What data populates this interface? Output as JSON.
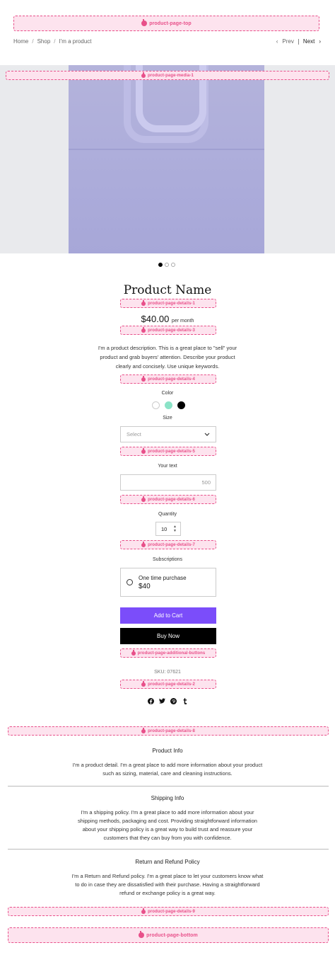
{
  "slots": {
    "top": "product-page-top",
    "media1": "product-page-media-1",
    "details1": "product-page-details-1",
    "details3": "product-page-details-3",
    "details4": "product-page-details-4",
    "details5": "product-page-details-5",
    "details6": "product-page-details-6",
    "details7": "product-page-details-7",
    "additional_buttons": "product-page-additional-buttons",
    "details2": "product-page-details-2",
    "details8": "product-page-details-8",
    "details9": "product-page-details-9",
    "bottom": "product-page-bottom"
  },
  "breadcrumb": {
    "home": "Home",
    "shop": "Shop",
    "current": "I'm a product",
    "sep": "/"
  },
  "pager": {
    "prev": "Prev",
    "next": "Next"
  },
  "gallery": {
    "dots": 3,
    "active": 0
  },
  "product": {
    "name": "Product Name",
    "price": "$40.00",
    "price_suffix": "per month",
    "description": "I'm a product description. This is a great place to \"sell\" your product and grab buyers' attention. Describe your product clearly and concisely. Use unique keywords."
  },
  "options": {
    "color_label": "Color",
    "colors": [
      "#ffffff",
      "#8be3c7",
      "#000000"
    ],
    "size_label": "Size",
    "size_placeholder": "Select",
    "text_label": "Your text",
    "text_counter": "500",
    "quantity_label": "Quantity",
    "quantity_value": "10",
    "subscriptions_label": "Subscriptions",
    "subscription_option": "One time purchase",
    "subscription_price": "$40"
  },
  "buttons": {
    "add_to_cart": "Add to Cart",
    "buy_now": "Buy Now"
  },
  "sku": "SKU: 07621",
  "social": [
    "facebook-icon",
    "twitter-icon",
    "pinterest-icon",
    "tumblr-icon"
  ],
  "info": [
    {
      "title": "Product Info",
      "text": "I'm a product detail. I'm a great place to add more information about your product such as sizing, material, care and cleaning instructions."
    },
    {
      "title": "Shipping Info",
      "text": "I'm a shipping policy. I'm a great place to add more information about your shipping methods, packaging and cost. Providing straightforward information about your shipping policy is a great way to build trust and reassure your customers that they can buy from you with confidence."
    },
    {
      "title": "Return and Refund Policy",
      "text": "I'm a Return and Refund policy. I'm a great place to let your customers know what to do in case they are dissatisfied with their purchase. Having a straightforward refund or exchange policy is a great way."
    }
  ],
  "colors": {
    "accent": "#7b4dfa",
    "slot": "#e8508a",
    "slot_bg": "#fde3ee"
  }
}
